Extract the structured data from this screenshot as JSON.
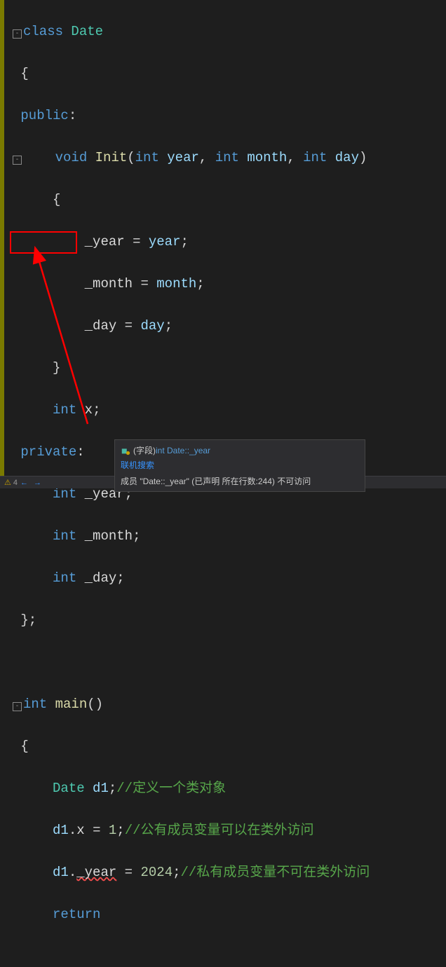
{
  "code": {
    "class_kw": "class",
    "class_name": "Date",
    "public_kw": "public",
    "private_kw": "private",
    "void_kw": "void",
    "int_kw": "int",
    "return_kw": "return",
    "fn_init": "Init",
    "fn_main": "main",
    "param_year": "year",
    "param_month": "month",
    "param_day": "day",
    "field_year": "_year",
    "field_month": "_month",
    "field_day": "_day",
    "field_x": "x",
    "var_d1": "d1",
    "num_1": "1",
    "num_2024": "2024",
    "comment_define": "//定义一个类对象",
    "comment_public": "//公有成员变量可以在类外访问",
    "comment_private": "//私有成员变量不可在类外访问"
  },
  "tooltip": {
    "field_label": "(字段)",
    "type_info": " int Date::_year",
    "search_link": "联机搜索",
    "error_msg": "成员 \"Date::_year\" (已声明 所在行数:244) 不可访问"
  },
  "statusbar": {
    "warning_count": "4"
  }
}
